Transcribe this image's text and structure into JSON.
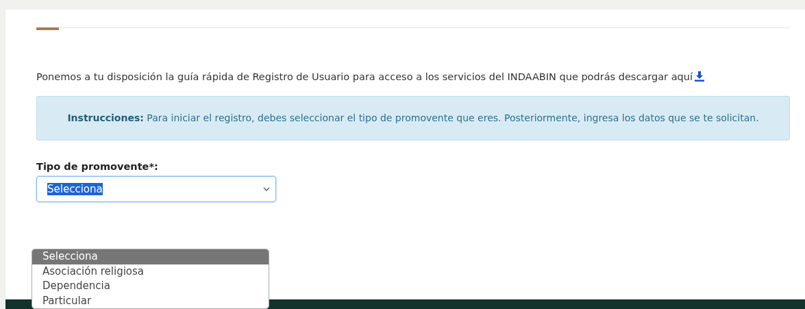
{
  "intro": {
    "text": "Ponemos a tu disposición la guía rápida de Registro de Usuario para acceso a los servicios del INDAABIN que podrás descargar",
    "link": "aquí"
  },
  "alert": {
    "text": "**Instrucciones:** Para iniciar el registro, debes seleccionar el tipo de promovente que eres. Posteriormente, ingresa los datos que se te solicitan."
  },
  "field": {
    "label": "Tipo de promovente*:",
    "value": "Selecciona"
  },
  "options": [
    {
      "label": "Selecciona",
      "selected": true
    },
    {
      "label": "Asociación religiosa",
      "selected": false
    },
    {
      "label": "Dependencia",
      "selected": false
    },
    {
      "label": "Particular",
      "selected": false
    }
  ]
}
